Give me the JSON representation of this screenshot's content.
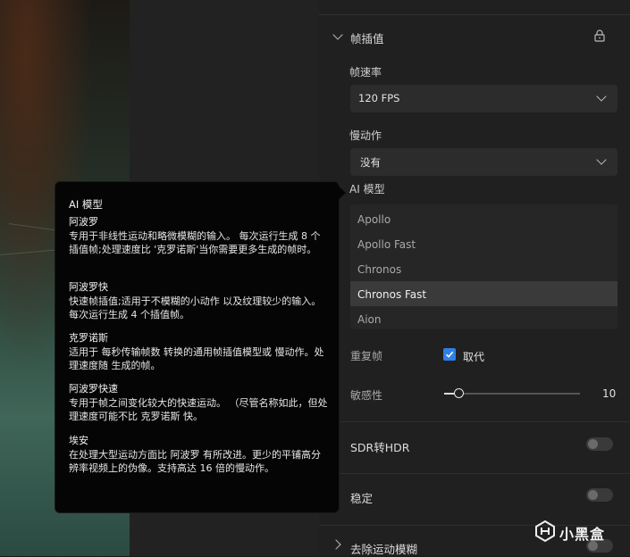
{
  "section_frame_interp": {
    "title": "帧插值",
    "frame_rate_label": "帧速率",
    "frame_rate_value": "120 FPS",
    "slowmo_label": "慢动作",
    "slowmo_value": "没有",
    "ai_model_label": "AI 模型",
    "models": [
      "Apollo",
      "Apollo Fast",
      "Chronos",
      "Chronos Fast",
      "Aion"
    ],
    "selected_model": "Chronos Fast",
    "duplicate_frames_label": "重复帧",
    "replace_label": "取代",
    "replace_checked": true,
    "sensitivity_label": "敏感性",
    "sensitivity_value": "10"
  },
  "sections": {
    "sdr_hdr": "SDR转HDR",
    "stabilize": "稳定",
    "deblur": "去除运动模糊"
  },
  "tooltip": {
    "title": "AI 模型",
    "apollo_title": "阿波罗",
    "apollo_desc": "专用于非线性运动和略微模糊的输入。 每次运行生成 8 个插值帧;处理速度比 '克罗诺斯'当你需要更多生成的帧时。",
    "apollo_fast_title": "阿波罗快",
    "apollo_fast_desc": "快速帧插值;适用于不模糊的小动作 以及纹理较少的输入。每次运行生成 4 个插值帧。",
    "chronos_title": "克罗诺斯",
    "chronos_desc": "适用于 每秒传输帧数 转换的通用帧插值模型或 慢动作。处理速度随 生成的帧。",
    "chronos_fast_title": "阿波罗快速",
    "chronos_fast_desc": "专用于帧之间变化较大的快速运动。 （尽管名称如此，但处理速度可能不比 克罗诺斯 快。",
    "aion_title": "埃安",
    "aion_desc": "在处理大型运动方面比 阿波罗 有所改进。更少的平铺高分辨率视频上的伪像。支持高达 16 倍的慢动作。"
  },
  "watermark": {
    "text": "小黑盒"
  },
  "colors": {
    "accent": "#2f7fe8",
    "panel_bg": "#202020",
    "tooltip_bg": "#050505"
  }
}
